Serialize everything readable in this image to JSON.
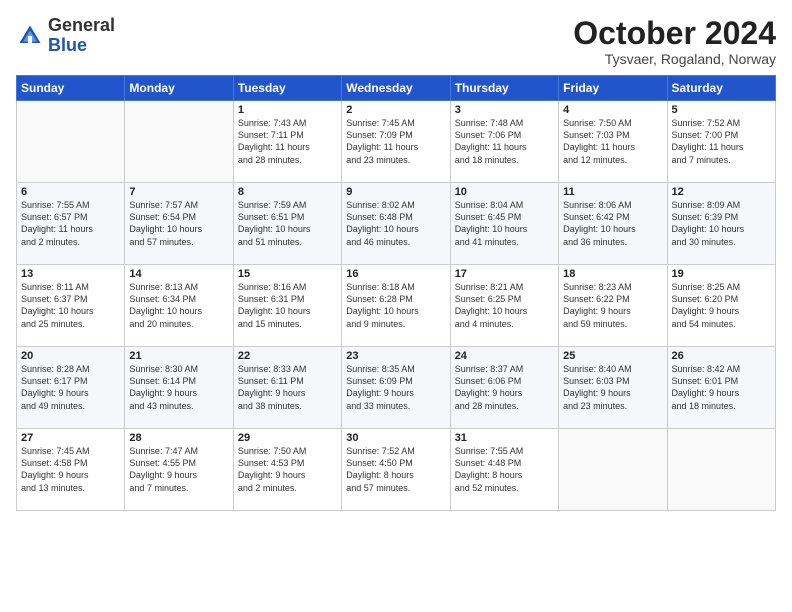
{
  "logo": {
    "general": "General",
    "blue": "Blue"
  },
  "title": "October 2024",
  "location": "Tysvaer, Rogaland, Norway",
  "headers": [
    "Sunday",
    "Monday",
    "Tuesday",
    "Wednesday",
    "Thursday",
    "Friday",
    "Saturday"
  ],
  "weeks": [
    [
      {
        "day": "",
        "info": ""
      },
      {
        "day": "",
        "info": ""
      },
      {
        "day": "1",
        "info": "Sunrise: 7:43 AM\nSunset: 7:11 PM\nDaylight: 11 hours\nand 28 minutes."
      },
      {
        "day": "2",
        "info": "Sunrise: 7:45 AM\nSunset: 7:09 PM\nDaylight: 11 hours\nand 23 minutes."
      },
      {
        "day": "3",
        "info": "Sunrise: 7:48 AM\nSunset: 7:06 PM\nDaylight: 11 hours\nand 18 minutes."
      },
      {
        "day": "4",
        "info": "Sunrise: 7:50 AM\nSunset: 7:03 PM\nDaylight: 11 hours\nand 12 minutes."
      },
      {
        "day": "5",
        "info": "Sunrise: 7:52 AM\nSunset: 7:00 PM\nDaylight: 11 hours\nand 7 minutes."
      }
    ],
    [
      {
        "day": "6",
        "info": "Sunrise: 7:55 AM\nSunset: 6:57 PM\nDaylight: 11 hours\nand 2 minutes."
      },
      {
        "day": "7",
        "info": "Sunrise: 7:57 AM\nSunset: 6:54 PM\nDaylight: 10 hours\nand 57 minutes."
      },
      {
        "day": "8",
        "info": "Sunrise: 7:59 AM\nSunset: 6:51 PM\nDaylight: 10 hours\nand 51 minutes."
      },
      {
        "day": "9",
        "info": "Sunrise: 8:02 AM\nSunset: 6:48 PM\nDaylight: 10 hours\nand 46 minutes."
      },
      {
        "day": "10",
        "info": "Sunrise: 8:04 AM\nSunset: 6:45 PM\nDaylight: 10 hours\nand 41 minutes."
      },
      {
        "day": "11",
        "info": "Sunrise: 8:06 AM\nSunset: 6:42 PM\nDaylight: 10 hours\nand 36 minutes."
      },
      {
        "day": "12",
        "info": "Sunrise: 8:09 AM\nSunset: 6:39 PM\nDaylight: 10 hours\nand 30 minutes."
      }
    ],
    [
      {
        "day": "13",
        "info": "Sunrise: 8:11 AM\nSunset: 6:37 PM\nDaylight: 10 hours\nand 25 minutes."
      },
      {
        "day": "14",
        "info": "Sunrise: 8:13 AM\nSunset: 6:34 PM\nDaylight: 10 hours\nand 20 minutes."
      },
      {
        "day": "15",
        "info": "Sunrise: 8:16 AM\nSunset: 6:31 PM\nDaylight: 10 hours\nand 15 minutes."
      },
      {
        "day": "16",
        "info": "Sunrise: 8:18 AM\nSunset: 6:28 PM\nDaylight: 10 hours\nand 9 minutes."
      },
      {
        "day": "17",
        "info": "Sunrise: 8:21 AM\nSunset: 6:25 PM\nDaylight: 10 hours\nand 4 minutes."
      },
      {
        "day": "18",
        "info": "Sunrise: 8:23 AM\nSunset: 6:22 PM\nDaylight: 9 hours\nand 59 minutes."
      },
      {
        "day": "19",
        "info": "Sunrise: 8:25 AM\nSunset: 6:20 PM\nDaylight: 9 hours\nand 54 minutes."
      }
    ],
    [
      {
        "day": "20",
        "info": "Sunrise: 8:28 AM\nSunset: 6:17 PM\nDaylight: 9 hours\nand 49 minutes."
      },
      {
        "day": "21",
        "info": "Sunrise: 8:30 AM\nSunset: 6:14 PM\nDaylight: 9 hours\nand 43 minutes."
      },
      {
        "day": "22",
        "info": "Sunrise: 8:33 AM\nSunset: 6:11 PM\nDaylight: 9 hours\nand 38 minutes."
      },
      {
        "day": "23",
        "info": "Sunrise: 8:35 AM\nSunset: 6:09 PM\nDaylight: 9 hours\nand 33 minutes."
      },
      {
        "day": "24",
        "info": "Sunrise: 8:37 AM\nSunset: 6:06 PM\nDaylight: 9 hours\nand 28 minutes."
      },
      {
        "day": "25",
        "info": "Sunrise: 8:40 AM\nSunset: 6:03 PM\nDaylight: 9 hours\nand 23 minutes."
      },
      {
        "day": "26",
        "info": "Sunrise: 8:42 AM\nSunset: 6:01 PM\nDaylight: 9 hours\nand 18 minutes."
      }
    ],
    [
      {
        "day": "27",
        "info": "Sunrise: 7:45 AM\nSunset: 4:58 PM\nDaylight: 9 hours\nand 13 minutes."
      },
      {
        "day": "28",
        "info": "Sunrise: 7:47 AM\nSunset: 4:55 PM\nDaylight: 9 hours\nand 7 minutes."
      },
      {
        "day": "29",
        "info": "Sunrise: 7:50 AM\nSunset: 4:53 PM\nDaylight: 9 hours\nand 2 minutes."
      },
      {
        "day": "30",
        "info": "Sunrise: 7:52 AM\nSunset: 4:50 PM\nDaylight: 8 hours\nand 57 minutes."
      },
      {
        "day": "31",
        "info": "Sunrise: 7:55 AM\nSunset: 4:48 PM\nDaylight: 8 hours\nand 52 minutes."
      },
      {
        "day": "",
        "info": ""
      },
      {
        "day": "",
        "info": ""
      }
    ]
  ]
}
